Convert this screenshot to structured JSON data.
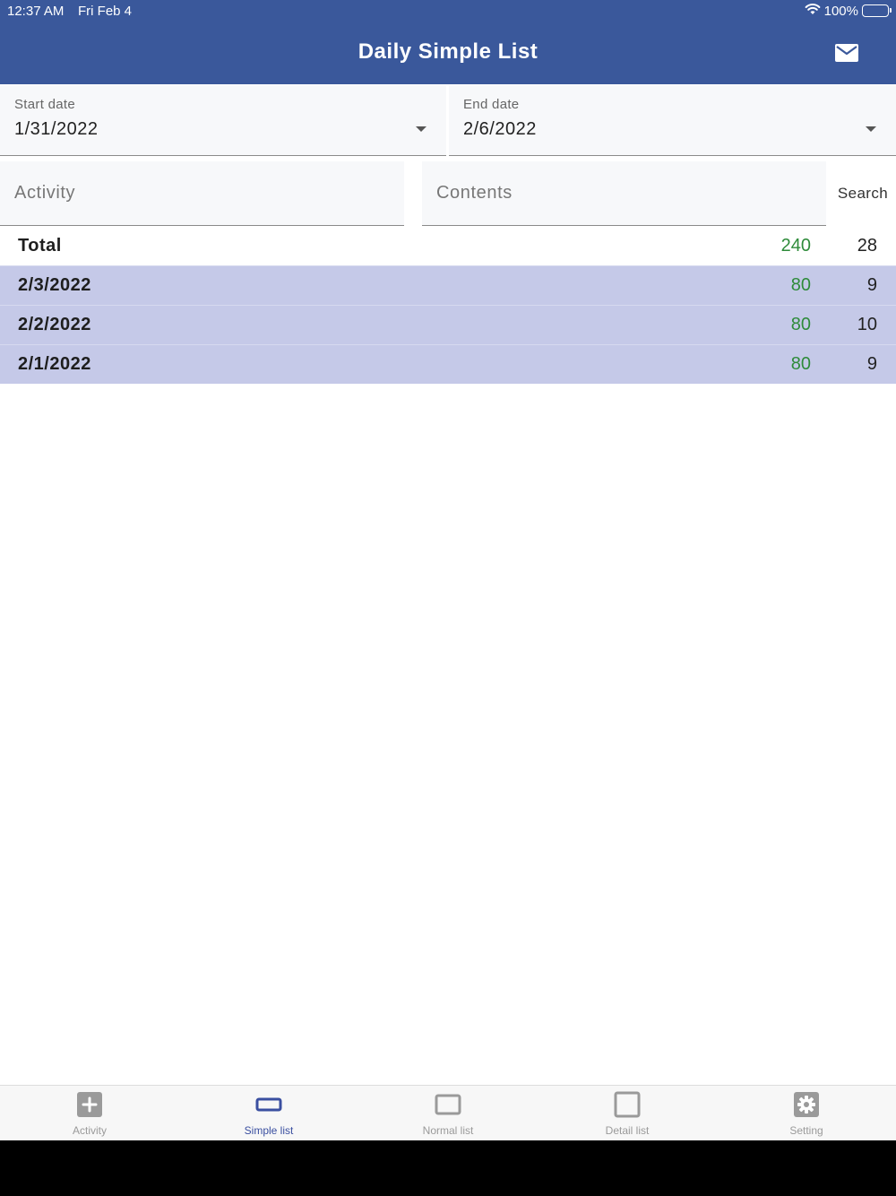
{
  "status_bar": {
    "time": "12:37 AM",
    "date": "Fri Feb 4",
    "battery": "100%"
  },
  "header": {
    "title": "Daily Simple List"
  },
  "filters": {
    "start_label": "Start date",
    "start_value": "1/31/2022",
    "end_label": "End date",
    "end_value": "2/6/2022",
    "activity_placeholder": "Activity",
    "contents_placeholder": "Contents",
    "search_label": "Search"
  },
  "list": {
    "total": {
      "label": "Total",
      "amount": "240",
      "count": "28"
    },
    "days": [
      {
        "label": "2/3/2022",
        "amount": "80",
        "count": "9"
      },
      {
        "label": "2/2/2022",
        "amount": "80",
        "count": "10"
      },
      {
        "label": "2/1/2022",
        "amount": "80",
        "count": "9"
      }
    ]
  },
  "nav": {
    "items": [
      {
        "label": "Activity",
        "icon": "plus-square-icon"
      },
      {
        "label": "Simple list",
        "icon": "rectangle-icon",
        "active": true
      },
      {
        "label": "Normal list",
        "icon": "rectangle-icon"
      },
      {
        "label": "Detail list",
        "icon": "square-icon"
      },
      {
        "label": "Setting",
        "icon": "gear-icon"
      }
    ]
  },
  "colors": {
    "header": "#3a589b",
    "row_highlight": "#c5c9e8",
    "amount_green": "#2e8b3a",
    "nav_active": "#3a4fa0",
    "nav_inactive": "#9a9a9a"
  }
}
